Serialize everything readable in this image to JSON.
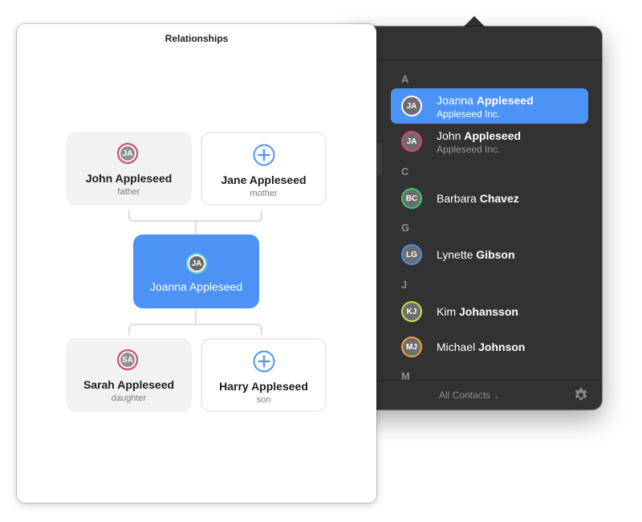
{
  "relationships": {
    "title": "Relationships",
    "parents": [
      {
        "name": "John Appleseed",
        "role": "father",
        "initials": "JA",
        "state": "filled"
      },
      {
        "name": "Jane Appleseed",
        "role": "mother",
        "initials": "",
        "state": "add"
      }
    ],
    "self": {
      "name": "Joanna Appleseed",
      "initials": "JA"
    },
    "children": [
      {
        "name": "Sarah Appleseed",
        "role": "daughter",
        "initials": "SA",
        "state": "filled"
      },
      {
        "name": "Harry Appleseed",
        "role": "son",
        "initials": "",
        "state": "add"
      }
    ]
  },
  "contacts": {
    "sections": [
      {
        "letter": "A",
        "items": [
          {
            "initials": "JA",
            "first": "Joanna",
            "last": "Appleseed",
            "company": "Appleseed Inc.",
            "selected": true,
            "ring": "#ffffff"
          },
          {
            "initials": "JA",
            "first": "John",
            "last": "Appleseed",
            "company": "Appleseed Inc.",
            "selected": false,
            "ring": "#e0416a"
          }
        ]
      },
      {
        "letter": "C",
        "items": [
          {
            "initials": "BC",
            "first": "Barbara",
            "last": "Chavez",
            "company": "",
            "selected": false,
            "ring": "#3fc466"
          }
        ]
      },
      {
        "letter": "G",
        "items": [
          {
            "initials": "LG",
            "first": "Lynette",
            "last": "Gibson",
            "company": "",
            "selected": false,
            "ring": "#4b8ff0"
          }
        ]
      },
      {
        "letter": "J",
        "items": [
          {
            "initials": "KJ",
            "first": "Kim",
            "last": "Johansson",
            "company": "",
            "selected": false,
            "ring": "#c8e04a"
          },
          {
            "initials": "MJ",
            "first": "Michael",
            "last": "Johnson",
            "company": "",
            "selected": false,
            "ring": "#f0a437"
          }
        ]
      },
      {
        "letter": "M",
        "items": []
      }
    ],
    "footer": {
      "scope": "All Contacts"
    }
  },
  "colors": {
    "accent": "#4c93f5",
    "panel": "#323232"
  }
}
